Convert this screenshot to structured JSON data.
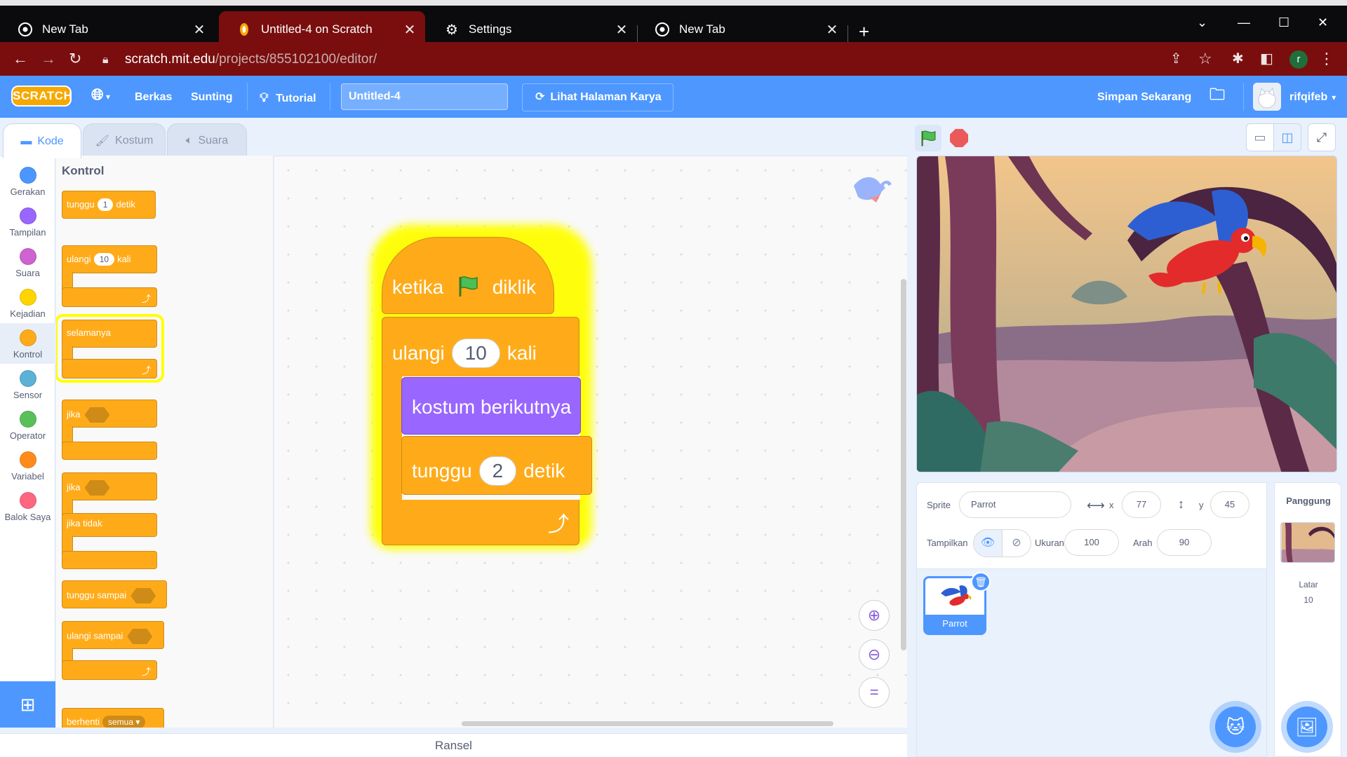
{
  "browser": {
    "tabs": [
      {
        "title": "New Tab"
      },
      {
        "title": "Untitled-4 on Scratch"
      },
      {
        "title": "Settings"
      },
      {
        "title": "New Tab"
      }
    ],
    "url_host": "scratch.mit.edu",
    "url_path": "/projects/855102100/editor/",
    "profile_initial": "r"
  },
  "menu": {
    "logo": "SCRATCH",
    "file": "Berkas",
    "edit": "Sunting",
    "tutorial": "Tutorial",
    "project_title": "Untitled-4",
    "see_project": "Lihat Halaman Karya",
    "save_now": "Simpan Sekarang",
    "username": "rifqifeb"
  },
  "editor_tabs": {
    "code": "Kode",
    "costumes": "Kostum",
    "sounds": "Suara"
  },
  "categories": [
    {
      "label": "Gerakan",
      "color": "#4c97ff"
    },
    {
      "label": "Tampilan",
      "color": "#9966ff"
    },
    {
      "label": "Suara",
      "color": "#cf63cf"
    },
    {
      "label": "Kejadian",
      "color": "#ffd500"
    },
    {
      "label": "Kontrol",
      "color": "#ffab19"
    },
    {
      "label": "Sensor",
      "color": "#5cb1d6"
    },
    {
      "label": "Operator",
      "color": "#59c059"
    },
    {
      "label": "Variabel",
      "color": "#ff8c1a"
    },
    {
      "label": "Balok Saya",
      "color": "#ff6680"
    }
  ],
  "palette": {
    "heading": "Kontrol",
    "wait_label": "tunggu",
    "wait_value": "1",
    "wait_unit": "detik",
    "repeat_label": "ulangi",
    "repeat_value": "10",
    "repeat_unit": "kali",
    "forever_label": "selamanya",
    "if_label": "jika",
    "if_else_label": "jika",
    "else_label": "jika tidak",
    "wait_until_label": "tunggu sampai",
    "repeat_until_label": "ulangi sampai",
    "stop_label": "berhenti",
    "stop_option": "semua"
  },
  "script": {
    "hat_when": "ketika",
    "hat_clicked": "diklik",
    "repeat_label": "ulangi",
    "repeat_value": "10",
    "repeat_unit": "kali",
    "next_costume": "kostum berikutnya",
    "wait_label": "tunggu",
    "wait_value": "2",
    "wait_unit": "detik"
  },
  "backpack": "Ransel",
  "sprite_info": {
    "sprite_label": "Sprite",
    "sprite_name": "Parrot",
    "x_label": "x",
    "x": "77",
    "y_label": "y",
    "y": "45",
    "show_label": "Tampilkan",
    "size_label": "Ukuran",
    "size": "100",
    "direction_label": "Arah",
    "direction": "90"
  },
  "sprites": [
    {
      "name": "Parrot"
    }
  ],
  "stage_panel": {
    "heading": "Panggung",
    "backdrops_label": "Latar",
    "backdrops_count": "10"
  },
  "colors": {
    "scratch_blue": "#4d97ff",
    "control": "#ffab19",
    "looks": "#9966ff",
    "browser_frame": "#7a0e0e"
  }
}
